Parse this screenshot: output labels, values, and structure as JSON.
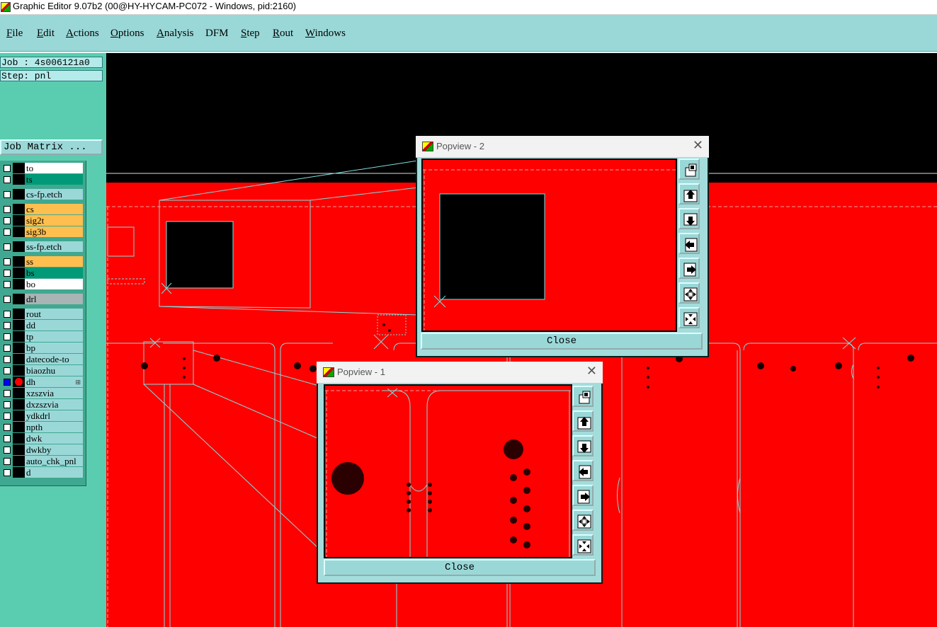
{
  "window": {
    "title": "Graphic Editor 9.07b2 (00@HY-HYCAM-PC072 - Windows, pid:2160)"
  },
  "menu": [
    {
      "u": "F",
      "rest": "ile"
    },
    {
      "u": "E",
      "rest": "dit"
    },
    {
      "u": "A",
      "rest": "ctions"
    },
    {
      "u": "O",
      "rest": "ptions"
    },
    {
      "u": "A",
      "rest": "nalysis"
    },
    {
      "u": "",
      "rest": "DFM"
    },
    {
      "u": "S",
      "rest": "tep"
    },
    {
      "u": "R",
      "rest": "out"
    },
    {
      "u": "W",
      "rest": "indows"
    }
  ],
  "job": {
    "label": "Job : 4s006121a0",
    "step": "Step: pnl",
    "matrix_button": "Job Matrix ..."
  },
  "layers": [
    {
      "name": "to",
      "color": "#ffffff"
    },
    {
      "name": "ts",
      "color": "#009a78"
    },
    {
      "name": "cs-fp.etch",
      "color": "#9ad8d8"
    },
    {
      "name": "cs",
      "color": "#ffbf4f"
    },
    {
      "name": "sig2t",
      "color": "#ffbf4f"
    },
    {
      "name": "sig3b",
      "color": "#ffbf4f"
    },
    {
      "name": "ss-fp.etch",
      "color": "#9ad8d8"
    },
    {
      "name": "ss",
      "color": "#ffbf4f"
    },
    {
      "name": "bs",
      "color": "#009a78"
    },
    {
      "name": "bo",
      "color": "#ffffff"
    },
    {
      "name": "drl",
      "color": "#a9b4b4"
    },
    {
      "name": "rout",
      "color": "#9ad8d8"
    },
    {
      "name": "dd",
      "color": "#9ad8d8"
    },
    {
      "name": "tp",
      "color": "#9ad8d8"
    },
    {
      "name": "bp",
      "color": "#9ad8d8"
    },
    {
      "name": "datecode-to",
      "color": "#9ad8d8"
    },
    {
      "name": "biaozhu",
      "color": "#9ad8d8"
    },
    {
      "name": "dh",
      "color": "#9ad8d8",
      "active": true
    },
    {
      "name": "xzszvia",
      "color": "#9ad8d8"
    },
    {
      "name": "dxzszvia",
      "color": "#9ad8d8"
    },
    {
      "name": "ydkdrl",
      "color": "#9ad8d8"
    },
    {
      "name": "npth",
      "color": "#9ad8d8"
    },
    {
      "name": "dwk",
      "color": "#9ad8d8"
    },
    {
      "name": "dwkby",
      "color": "#9ad8d8"
    },
    {
      "name": "auto_chk_pnl",
      "color": "#9ad8d8"
    },
    {
      "name": "d",
      "color": "#9ad8d8"
    }
  ],
  "popview2": {
    "title": "Popview - 2",
    "close": "Close"
  },
  "popview1": {
    "title": "Popview - 1",
    "close": "Close"
  },
  "popview_buttons": [
    "zoom-home-icon",
    "pan-up-icon",
    "pan-down-icon",
    "pan-left-icon",
    "pan-right-icon",
    "zoom-in-icon",
    "zoom-out-icon"
  ],
  "colors": {
    "board": "#ff0000",
    "outline": "#7fdede",
    "panel": "#9ad8d8"
  }
}
